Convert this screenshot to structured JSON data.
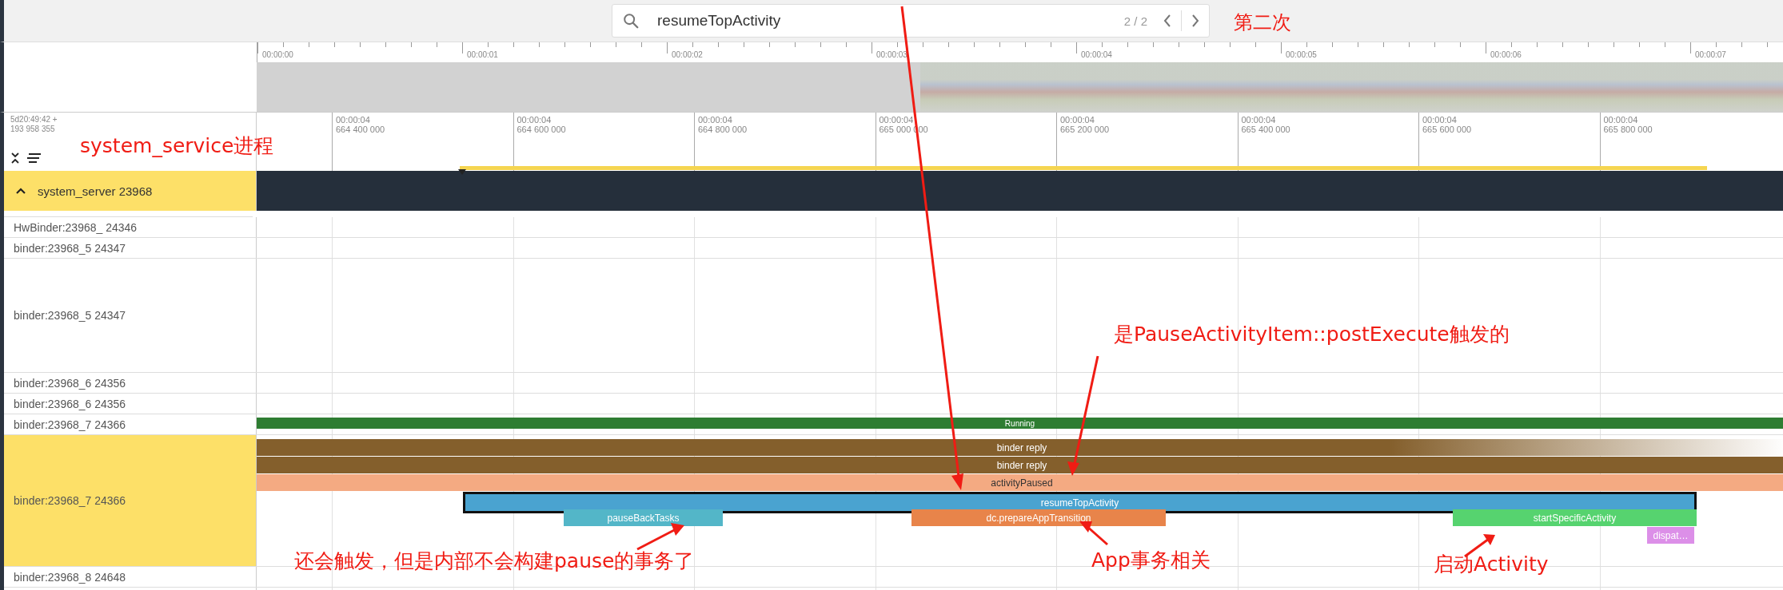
{
  "search": {
    "value": "resumeTopActivity",
    "counter": "2 / 2"
  },
  "overview": {
    "ticks": [
      "00:00:00",
      "00:00:01",
      "00:00:02",
      "00:00:03",
      "00:00:04",
      "00:00:05",
      "00:00:06",
      "00:00:07"
    ]
  },
  "time_axis": {
    "origin": "5d20:49:42 +",
    "origin_offset": "193 958 355",
    "ticks": [
      {
        "time": "00:00:04",
        "offset": "664 400 000"
      },
      {
        "time": "00:00:04",
        "offset": "664 600 000"
      },
      {
        "time": "00:00:04",
        "offset": "664 800 000"
      },
      {
        "time": "00:00:04",
        "offset": "665 000 000"
      },
      {
        "time": "00:00:04",
        "offset": "665 200 000"
      },
      {
        "time": "00:00:04",
        "offset": "665 400 000"
      },
      {
        "time": "00:00:04",
        "offset": "665 600 000"
      },
      {
        "time": "00:00:04",
        "offset": "665 800 000"
      }
    ]
  },
  "process": {
    "label": "system_server 23968",
    "expanded": true,
    "selected": true
  },
  "threads": [
    {
      "label": "HwBinder:23968_ 24346",
      "expanded": false,
      "selected": false
    },
    {
      "label": "binder:23968_5 24347",
      "expanded": false,
      "selected": false
    },
    {
      "label": "binder:23968_5 24347",
      "expanded": true,
      "selected": false
    },
    {
      "label": "binder:23968_6 24356",
      "expanded": false,
      "selected": false
    },
    {
      "label": "binder:23968_6 24356",
      "expanded": false,
      "selected": false
    },
    {
      "label": "binder:23968_7 24366",
      "expanded": false,
      "selected": false,
      "state_bar": {
        "label": "Running",
        "color": "#2e7d32"
      }
    },
    {
      "label": "binder:23968_7 24366",
      "expanded": true,
      "selected": true,
      "slices": [
        {
          "label": "binder reply",
          "color": "#845f2c",
          "faded": true,
          "selected": false,
          "children": [
            {
              "label": "binder reply",
              "color": "#845f2c",
              "faded": false,
              "selected": false,
              "children": [
                {
                  "label": "activityPaused",
                  "color": "#f4aa82",
                  "faded": false,
                  "selected": false,
                  "children": [
                    {
                      "label": "resumeTopActivity",
                      "color": "#4aa3d0",
                      "faded": false,
                      "selected": true,
                      "children": [
                        {
                          "label": "pauseBackTasks",
                          "color": "#53b6c8",
                          "faded": false,
                          "selected": false
                        },
                        {
                          "label": "dc.prepareAppTransition",
                          "color": "#e8844a",
                          "faded": false,
                          "selected": false
                        },
                        {
                          "label": "startSpecificActivity",
                          "color": "#56d36f",
                          "faded": false,
                          "selected": false,
                          "children": [
                            {
                              "label": "dispat…",
                              "color": "#dc8fe8",
                              "faded": false,
                              "selected": false
                            }
                          ]
                        }
                      ]
                    }
                  ]
                }
              ]
            }
          ]
        }
      ]
    },
    {
      "label": "binder:23968_8 24648",
      "expanded": false,
      "selected": false
    }
  ],
  "annotations": [
    {
      "text": "第二次"
    },
    {
      "text": "system_service进程"
    },
    {
      "text": "是PauseActivityItem::postExecute触发的"
    },
    {
      "text": "还会触发，但是内部不会构建pause的事务了"
    },
    {
      "text": "App事务相关"
    },
    {
      "text": "启动Activity"
    }
  ]
}
